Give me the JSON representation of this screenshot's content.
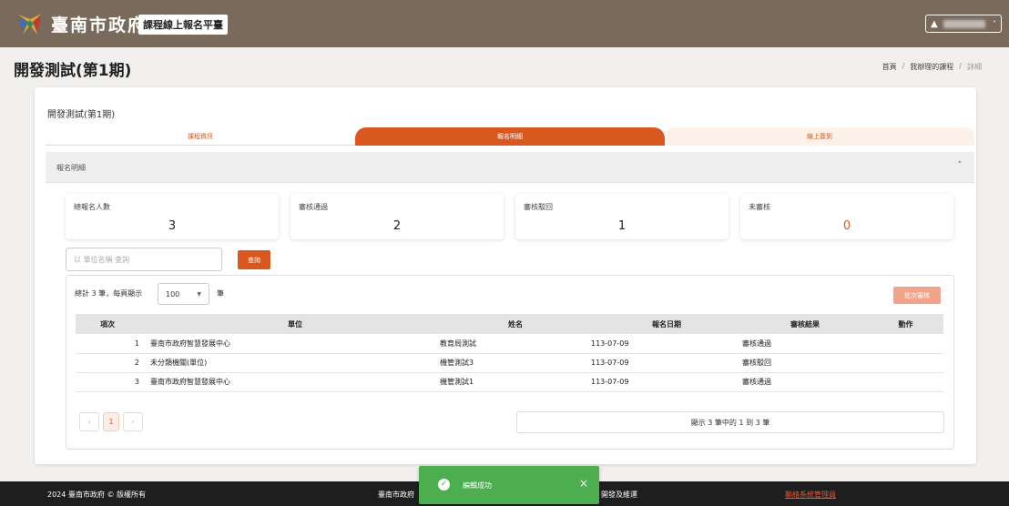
{
  "header": {
    "site_title": "臺南市政府",
    "platform_label": "課程線上報名平臺",
    "user_menu": {
      "icon": "user-icon",
      "caret": "˅"
    },
    "colors": {
      "topbar": "#7a6a5b",
      "accent": "#d8581f"
    }
  },
  "page": {
    "title": "開發測試(第1期)",
    "breadcrumb": {
      "home": "首頁",
      "separator": "/",
      "courses": "我辦理的課程",
      "current": "詳細"
    }
  },
  "course_card": {
    "title": "開發測試(第1期)",
    "tabs": [
      "課程資訊",
      "報名明細",
      "線上簽到"
    ],
    "active_tab": "報名明細"
  },
  "registration": {
    "section_title": "報名明細",
    "section_caret": "˄",
    "stats": [
      {
        "label": "總報名人數",
        "value": "3"
      },
      {
        "label": "審核通過",
        "value": "2"
      },
      {
        "label": "審核駁回",
        "value": "1"
      },
      {
        "label": "未審核",
        "value": "0"
      }
    ],
    "search": {
      "placeholder": "以 單位名稱 查詢",
      "button": "查詢"
    },
    "pager": {
      "summary": "總計 3 筆，每頁顯示",
      "page_size": "100",
      "unit": "筆"
    },
    "batch_button": "批次審核",
    "table": {
      "headers": [
        "項次",
        "單位",
        "姓名",
        "報名日期",
        "審核結果",
        "動作"
      ],
      "rows": [
        [
          "1",
          "臺南市政府智慧發展中心",
          "教育局測試",
          "113-07-09",
          "審核通過",
          ""
        ],
        [
          "2",
          "未分類機關(單位)",
          "機管測試3",
          "113-07-09",
          "審核駁回",
          ""
        ],
        [
          "3",
          "臺南市政府智慧發展中心",
          "機管測試1",
          "113-07-09",
          "審核通過",
          ""
        ]
      ]
    },
    "pagination": {
      "prev": "‹",
      "page": "1",
      "next": "›"
    },
    "showing": "顯示 3 筆中的 1 到 3 筆"
  },
  "footer": {
    "copyright": "2024 臺南市政府 © 版權所有",
    "mid_left": "臺南市政府",
    "mid_right": "開發及維運",
    "contact": "聯絡系統管理員"
  },
  "toast": {
    "message": "編輯成功",
    "close": "×"
  }
}
